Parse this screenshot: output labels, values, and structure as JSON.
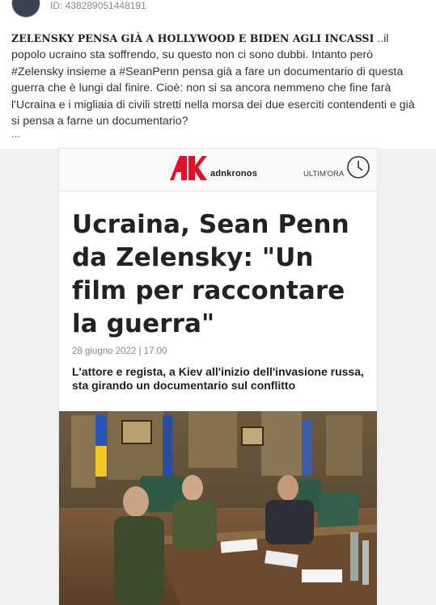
{
  "post": {
    "id_label": "ID: 438289051448191",
    "headline": "ZELENSKY PENSA GIÀ A HOLLYWOOD E BIDEN AGLI INCASSI",
    "body": " ..il popolo ucraino sta soffrendo, su questo non ci sono dubbi. Intanto però #Zelensky insieme a #SeanPenn pensa già a fare un documentario di questa guerra che è lungi dal finire. Cioè: non si sa ancora nemmeno che fine farà l'Ucraina e i migliaia di civili stretti nella morsa dei due eserciti contendenti e già si pensa a farne un documentario?",
    "ellipsis": "..."
  },
  "article": {
    "logo_text": "adnkronos",
    "ultimora": "ULTIM'ORA",
    "title": "Ucraina, Sean Penn da Zelensky: \"Un film per raccontare la guerra\"",
    "date": "28 giugno 2022 | 17.00",
    "subtitle": "L'attore e regista, a Kiev all'inizio dell'invasione russa, sta girando un documentario sul conflitto"
  },
  "colors": {
    "brand_red": "#e3102a",
    "text": "#333333",
    "meta": "#8a8a8a"
  },
  "icons": [
    "avatar",
    "adnkronos-logo-icon",
    "clock-icon",
    "news-photo"
  ]
}
